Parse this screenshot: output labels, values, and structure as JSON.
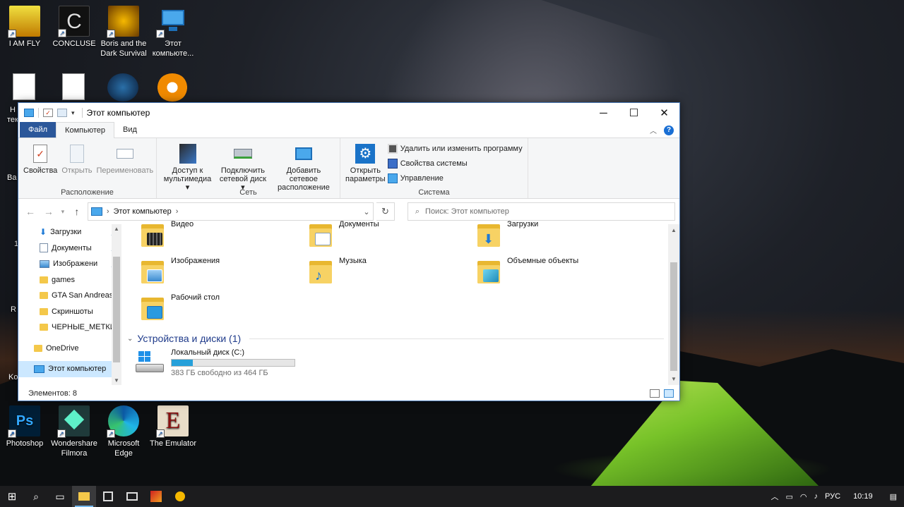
{
  "desktop": {
    "icons_top": [
      {
        "label": "I AM FLY",
        "color": "#e0c000"
      },
      {
        "label": "CONCLUSE",
        "color": "#111111"
      },
      {
        "label": "Boris and the Dark Survival",
        "color": "#d79a00"
      },
      {
        "label": "Этот компьюте...",
        "color": "#2f8fd8"
      }
    ],
    "icons_bottom": [
      {
        "label": "Photoshop",
        "color": "#001e36"
      },
      {
        "label": "Wondershare Filmora",
        "color": "#1f3a3a"
      },
      {
        "label": "Microsoft Edge",
        "color": "#1682d4"
      },
      {
        "label": "The Emulator",
        "color": "#6b0f0f"
      }
    ],
    "partial_labels": [
      "Н",
      "тек",
      "Ba",
      "1",
      "R",
      "Ko"
    ]
  },
  "window": {
    "title": "Этот компьютер",
    "controls": {
      "minimize": "─",
      "maximize": "☐",
      "close": "✕"
    },
    "tabs": [
      "Файл",
      "Компьютер",
      "Вид"
    ],
    "ribbon": {
      "location": {
        "label": "Расположение",
        "buttons": [
          "Свойства",
          "Открыть",
          "Переименовать"
        ]
      },
      "network": {
        "label": "Сеть",
        "buttons": [
          {
            "line1": "Доступ к",
            "line2": "мультимедиа ▾"
          },
          {
            "line1": "Подключить",
            "line2": "сетевой диск ▾"
          },
          {
            "line1": "Добавить сетевое",
            "line2": "расположение"
          }
        ]
      },
      "system": {
        "label": "Система",
        "open_settings": {
          "line1": "Открыть",
          "line2": "параметры"
        },
        "small": [
          "Удалить или изменить программу",
          "Свойства системы",
          "Управление"
        ]
      }
    },
    "address": {
      "path": "Этот компьютер",
      "search_placeholder": "Поиск: Этот компьютер"
    },
    "nav": [
      {
        "label": "Загрузки",
        "pinned": true,
        "icon": "download-icon"
      },
      {
        "label": "Документы",
        "pinned": true,
        "icon": "documents-icon"
      },
      {
        "label": "Изображени",
        "pinned": true,
        "icon": "pictures-icon"
      },
      {
        "label": "games",
        "pinned": false,
        "icon": "folder-icon"
      },
      {
        "label": "GTA San Andreas",
        "pinned": false,
        "icon": "folder-icon"
      },
      {
        "label": "Скриншоты",
        "pinned": false,
        "icon": "folder-icon"
      },
      {
        "label": "ЧЕРНЫЕ_МЕТКИ",
        "pinned": false,
        "icon": "folder-icon"
      },
      {
        "label": "OneDrive",
        "pinned": false,
        "icon": "onedrive-icon"
      },
      {
        "label": "Этот компьютер",
        "pinned": false,
        "icon": "computer-icon"
      }
    ],
    "folders": [
      "Видео",
      "Документы",
      "Загрузки",
      "Изображения",
      "Музыка",
      "Объемные объекты",
      "Рабочий стол"
    ],
    "devices_section": "Устройства и диски (1)",
    "drive": {
      "name": "Локальный диск (C:)",
      "free_text": "383 ГБ свободно из 464 ГБ",
      "used_fraction": 0.175
    },
    "status": "Элементов: 8"
  },
  "taskbar": {
    "lang": "РУС",
    "time": "10:19"
  }
}
